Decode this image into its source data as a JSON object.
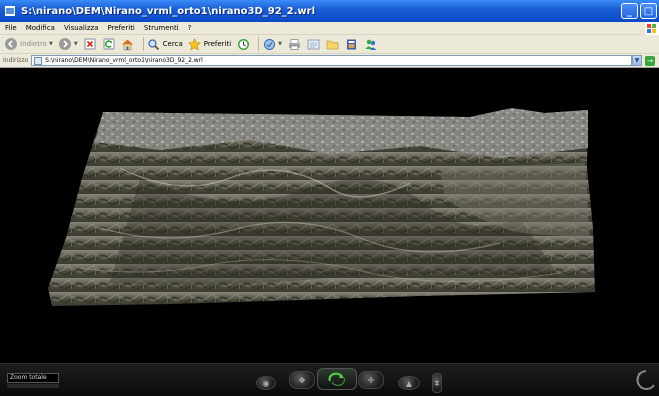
{
  "window": {
    "title": "S:\\nirano\\DEM\\Nirano_vrml_orto1\\nirano3D_92_2.wrl",
    "minimize": "_",
    "maximize": "□"
  },
  "menu": [
    "File",
    "Modifica",
    "Visualizza",
    "Preferiti",
    "Strumenti",
    "?"
  ],
  "toolbar": {
    "back_label": "Indietro",
    "search_label": "Cerca",
    "favorites_label": "Preferiti"
  },
  "address": {
    "label": "Indirizzo",
    "value": "S:\\nirano\\DEM\\Nirano_vrml_orto1\\nirano3D_92_2.wrl"
  },
  "viewer": {
    "viewpoint": "Zoom totale"
  },
  "colors": {
    "titlebar": "#0b49c6",
    "chrome": "#ece9d8",
    "viewport_bg": "#000000"
  }
}
